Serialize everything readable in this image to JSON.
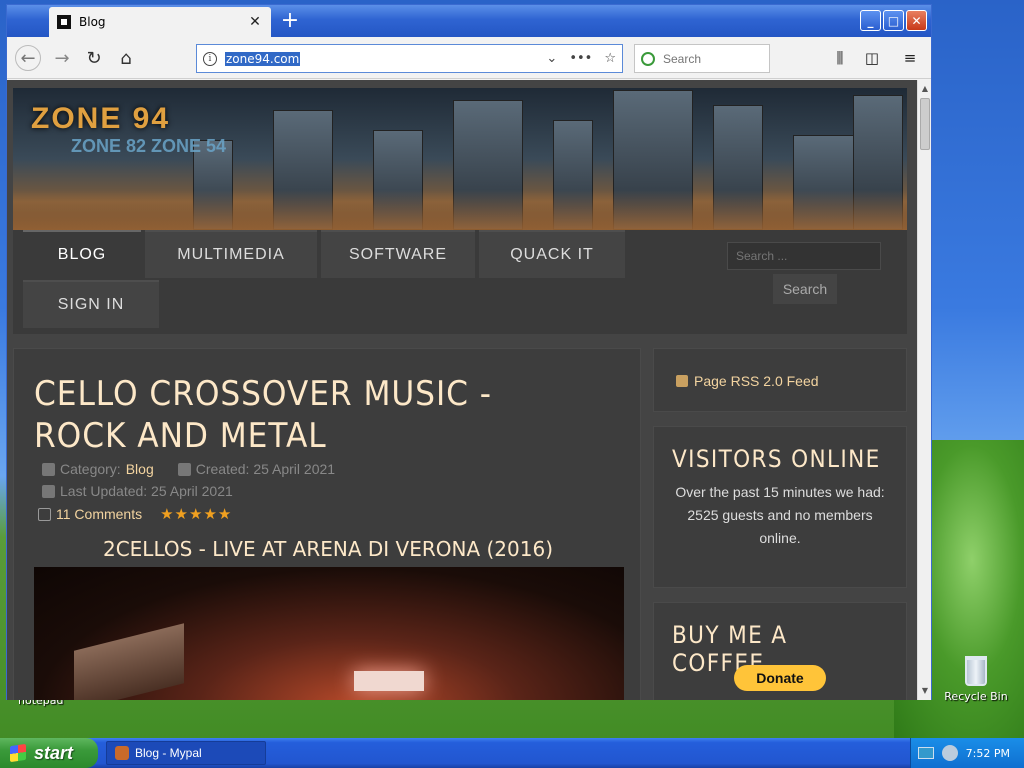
{
  "browser": {
    "tab_title": "Blog",
    "tab_close": "✕",
    "new_tab": "+",
    "url": "zone94.com",
    "search_placeholder": "Search",
    "window_buttons": [
      "_",
      "□",
      "✕"
    ]
  },
  "site": {
    "logo_primary": "ZONE 94",
    "logo_secondary": "ZONE 82 ZONE 54",
    "menu": [
      "BLOG",
      "MULTIMEDIA",
      "SOFTWARE",
      "QUACK IT",
      "SIGN IN"
    ],
    "active_menu": "BLOG",
    "search_placeholder": "Search ...",
    "search_button": "Search"
  },
  "article": {
    "title": "CELLO CROSSOVER MUSIC - ROCK AND METAL",
    "category_label": "Category:",
    "category": "Blog",
    "created": "Created: 25 April 2021",
    "updated": "Last Updated: 25 April 2021",
    "comments": "11 Comments",
    "rating_stars": 5,
    "video_title": "2CELLOS - LIVE AT ARENA DI VERONA (2016)"
  },
  "sidebar": {
    "rss": "Page RSS 2.0 Feed",
    "visitors_heading": "VISITORS ONLINE",
    "visitors_text": "Over the past 15 minutes we had: 2525 guests and no members online.",
    "coffee_heading": "BUY ME A COFFEE",
    "donate": "Donate"
  },
  "desktop": {
    "recycle_bin": "Recycle Bin",
    "notepad": "notepad"
  },
  "taskbar": {
    "start": "start",
    "window": "Blog - Mypal",
    "clock": "7:52 PM"
  }
}
